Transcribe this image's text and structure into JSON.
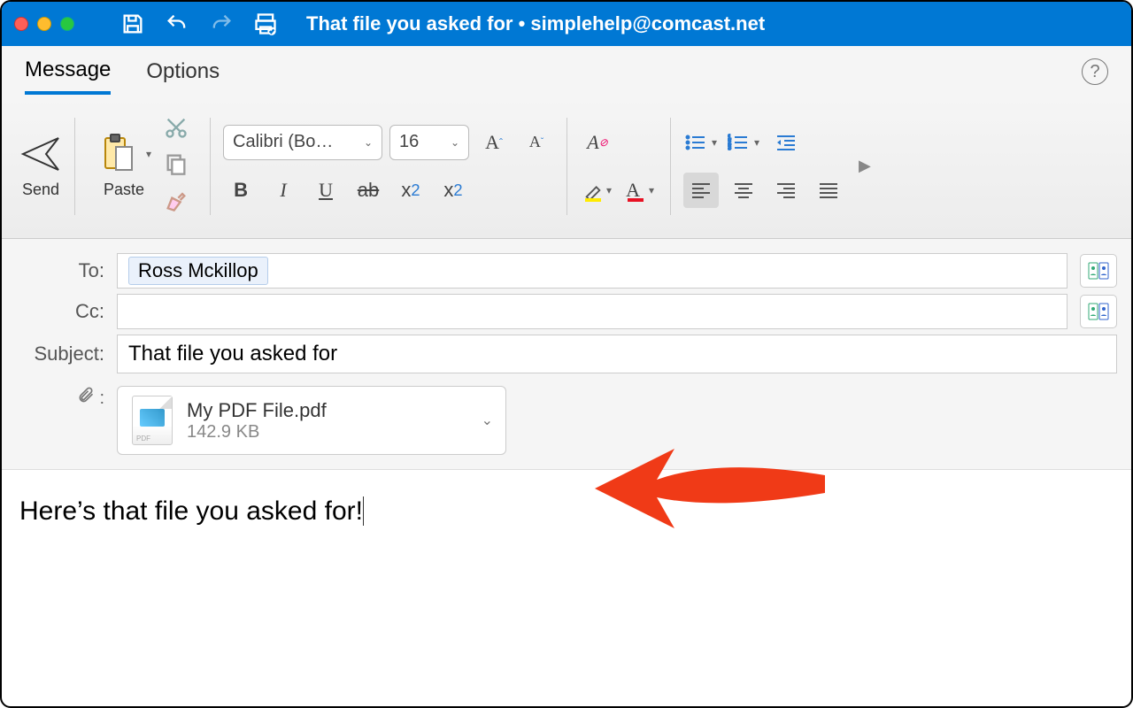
{
  "window": {
    "title": "That file you asked for • simplehelp@comcast.net"
  },
  "tabs": {
    "message": "Message",
    "options": "Options"
  },
  "ribbon": {
    "send": "Send",
    "paste": "Paste",
    "font_name": "Calibri (Bo…",
    "font_size": "16"
  },
  "address": {
    "to_label": "To:",
    "cc_label": "Cc:",
    "subject_label": "Subject:",
    "to_recipient": "Ross Mckillop",
    "subject_value": "That file you asked for"
  },
  "attachment": {
    "filename": "My PDF File.pdf",
    "filesize": "142.9 KB"
  },
  "body": {
    "text": "Here’s that file you asked for!"
  }
}
